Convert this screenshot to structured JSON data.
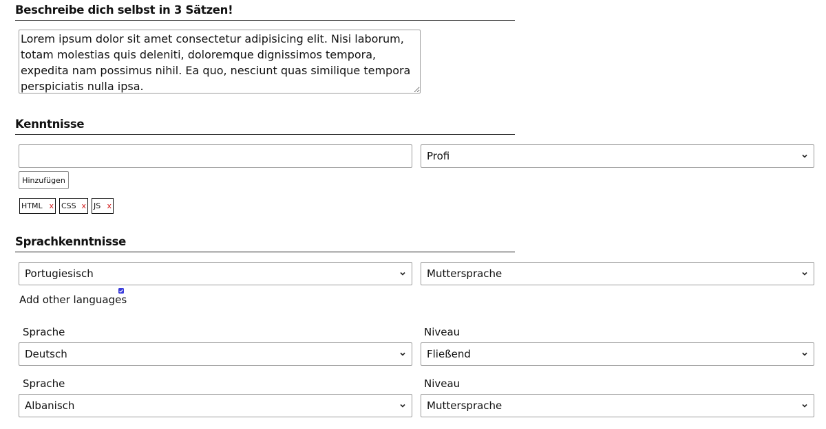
{
  "about": {
    "title": "Beschreibe dich selbst in 3 Sätzen!",
    "text": "Lorem ipsum dolor sit amet consectetur adipisicing elit. Nisi laborum, totam molestias quis deleniti, doloremque dignissimos tempora, expedita nam possimus nihil. Ea quo, nesciunt quas similique tempora perspiciatis nulla ipsa."
  },
  "skills": {
    "title": "Kenntnisse",
    "input_value": "",
    "level_selected": "Profi",
    "add_button": "Hinzufügen",
    "remove_symbol": "x",
    "tags": [
      "HTML",
      "CSS",
      "JS"
    ]
  },
  "languages": {
    "title": "Sprachkenntnisse",
    "primary_language": "Portugiesisch",
    "primary_level": "Muttersprache",
    "add_other_label": "Add other languages",
    "add_other_checked": true,
    "language_label": "Sprache",
    "level_label": "Niveau",
    "extra": [
      {
        "language": "Deutsch",
        "level": "Fließend"
      },
      {
        "language": "Albanisch",
        "level": "Muttersprache"
      }
    ]
  },
  "colors": {
    "remove_x": "#d11919",
    "checkbox": "#3b3ddb",
    "border": "#9b9b9b"
  }
}
